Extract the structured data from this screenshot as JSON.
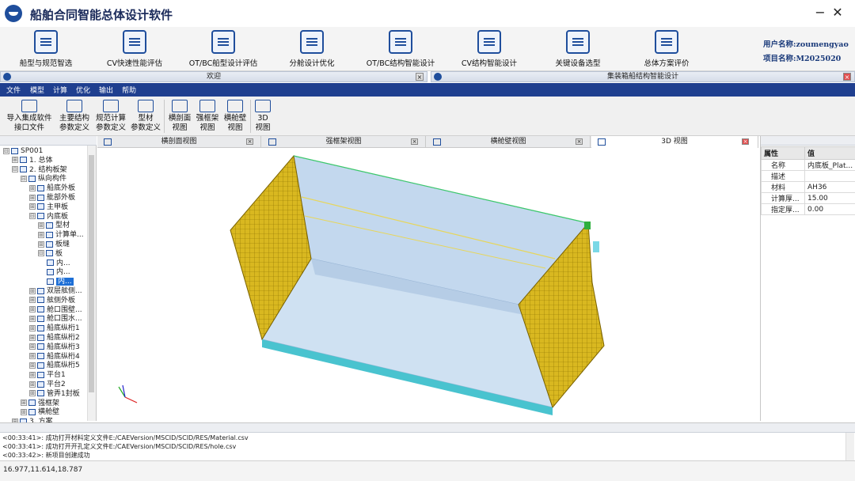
{
  "app": {
    "title": "船舶合同智能总体设计软件",
    "minimize_glyph": "−",
    "close_glyph": "✕"
  },
  "ribbon": [
    {
      "label": "船型与规范智选",
      "icon": "ship-form-icon"
    },
    {
      "label": "CV快速性能评估",
      "icon": "cfd-icon"
    },
    {
      "label": "OT/BC船型设计评估",
      "icon": "cfd-ship-icon"
    },
    {
      "label": "分舱设计优化",
      "icon": "compartment-icon"
    },
    {
      "label": "OT/BC结构智能设计",
      "icon": "str-icon"
    },
    {
      "label": "CV结构智能设计",
      "icon": "str-cv-icon"
    },
    {
      "label": "关键设备选型",
      "icon": "equipment-icon"
    },
    {
      "label": "总体方案评价",
      "icon": "evaluation-icon"
    }
  ],
  "user": {
    "name_line": "用户名称:zoumengyao",
    "project_line": "项目名称:M2025020"
  },
  "docks": {
    "left_title": "欢迎",
    "right_title": "集装箱船结构智能设计"
  },
  "menu": [
    "文件",
    "模型",
    "计算",
    "优化",
    "输出",
    "帮助"
  ],
  "toolbar": [
    {
      "label1": "导入集成软件",
      "label2": "接口文件",
      "icon": "import-icon"
    },
    {
      "label1": "主要结构",
      "label2": "参数定义",
      "icon": "structure-params-icon"
    },
    {
      "label1": "规范计算",
      "label2": "参数定义",
      "icon": "rule-calc-icon"
    },
    {
      "label1": "型材",
      "label2": "参数定义",
      "icon": "profile-icon"
    },
    {
      "label1": "横剖面",
      "label2": "视图",
      "icon": "section-view-icon"
    },
    {
      "label1": "强框架",
      "label2": "视图",
      "icon": "web-frame-icon"
    },
    {
      "label1": "横舱壁",
      "label2": "视图",
      "icon": "bulkhead-icon"
    },
    {
      "label1": "3D",
      "label2": "视图",
      "icon": "view-3d-icon"
    }
  ],
  "tree": [
    {
      "indent": 0,
      "pm": "⊟",
      "label": "SP001"
    },
    {
      "indent": 1,
      "pm": "⊞",
      "label": "1. 总体"
    },
    {
      "indent": 1,
      "pm": "⊟",
      "label": "2. 结构板架"
    },
    {
      "indent": 2,
      "pm": "⊟",
      "label": "纵向构件"
    },
    {
      "indent": 3,
      "pm": "⊞",
      "label": "船底外板"
    },
    {
      "indent": 3,
      "pm": "⊞",
      "label": "舭部外板"
    },
    {
      "indent": 3,
      "pm": "⊞",
      "label": "主甲板"
    },
    {
      "indent": 3,
      "pm": "⊟",
      "label": "内底板"
    },
    {
      "indent": 4,
      "pm": "⊞",
      "label": "型材"
    },
    {
      "indent": 4,
      "pm": "⊞",
      "label": "计算单..."
    },
    {
      "indent": 4,
      "pm": "⊞",
      "label": "板缝"
    },
    {
      "indent": 4,
      "pm": "⊟",
      "label": "板"
    },
    {
      "indent": 5,
      "pm": "",
      "label": "内..."
    },
    {
      "indent": 5,
      "pm": "",
      "label": "内..."
    },
    {
      "indent": 5,
      "pm": "",
      "label": "内...",
      "selected": true
    },
    {
      "indent": 3,
      "pm": "⊞",
      "label": "双层舷侧..."
    },
    {
      "indent": 3,
      "pm": "⊞",
      "label": "舷侧外板"
    },
    {
      "indent": 3,
      "pm": "⊞",
      "label": "舱口围壁..."
    },
    {
      "indent": 3,
      "pm": "⊞",
      "label": "舱口围水..."
    },
    {
      "indent": 3,
      "pm": "⊞",
      "label": "船底纵桁1"
    },
    {
      "indent": 3,
      "pm": "⊞",
      "label": "船底纵桁2"
    },
    {
      "indent": 3,
      "pm": "⊞",
      "label": "船底纵桁3"
    },
    {
      "indent": 3,
      "pm": "⊞",
      "label": "船底纵桁4"
    },
    {
      "indent": 3,
      "pm": "⊞",
      "label": "船底纵桁5"
    },
    {
      "indent": 3,
      "pm": "⊞",
      "label": "平台1"
    },
    {
      "indent": 3,
      "pm": "⊞",
      "label": "平台2"
    },
    {
      "indent": 3,
      "pm": "⊞",
      "label": "管弄1封板"
    },
    {
      "indent": 2,
      "pm": "⊞",
      "label": "强框架"
    },
    {
      "indent": 2,
      "pm": "⊞",
      "label": "横舱壁"
    },
    {
      "indent": 1,
      "pm": "⊞",
      "label": "3. 方案"
    }
  ],
  "tabs": [
    {
      "label": "横剖面视图",
      "icon": "section-tab-icon"
    },
    {
      "label": "强框架视图",
      "icon": "frame-tab-icon"
    },
    {
      "label": "横舱壁视图",
      "icon": "bulkhead-tab-icon"
    },
    {
      "label": "3D 视图",
      "icon": "3d-tab-icon",
      "active": true
    }
  ],
  "properties": {
    "headers": [
      "属性",
      "值"
    ],
    "rows": [
      {
        "key": "名称",
        "value": "内底板_Plat..."
      },
      {
        "key": "描述",
        "value": ""
      },
      {
        "key": "材料",
        "value": "AH36"
      },
      {
        "key": "计算厚...",
        "value": "15.00"
      },
      {
        "key": "指定厚...",
        "value": "0.00"
      }
    ]
  },
  "log": [
    "<00:33:41>: 成功打开材料定义文件E:/CAEVersion/MSCID/SCID/RES/Material.csv",
    "<00:33:41>: 成功打开开孔定义文件E:/CAEVersion/MSCID/SCID/RES/hole.csv",
    "<00:33:42>: 新项目创建成功"
  ],
  "status": {
    "coords": "16.977,11.614,18.787"
  },
  "colors": {
    "accent": "#1f3f8f",
    "plate": "#c9dcf0",
    "stiffener": "#d4b21a",
    "edge": "#49c3cf"
  }
}
